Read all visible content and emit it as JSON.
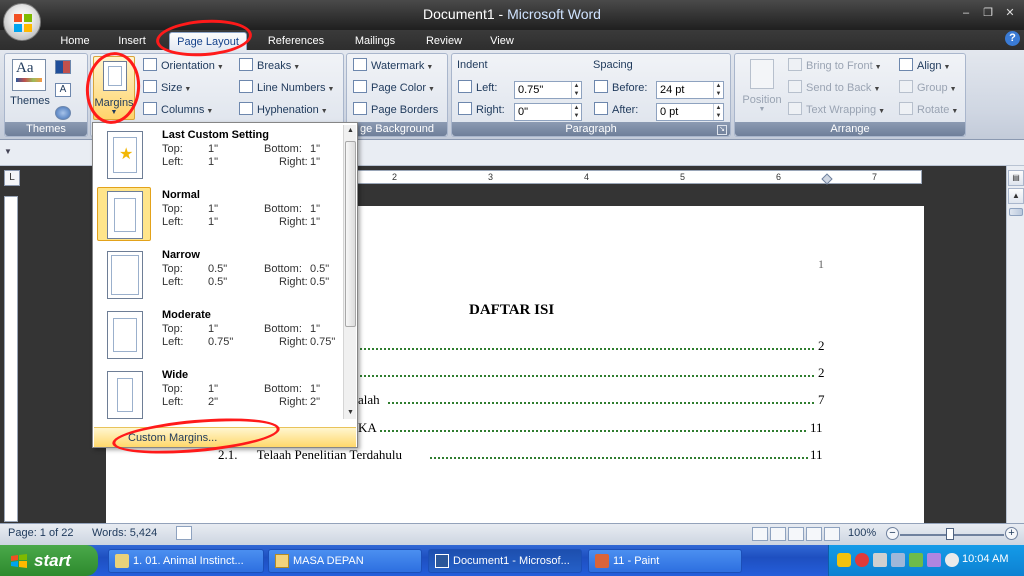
{
  "window": {
    "doc_name": "Document1",
    "title_sep": " - ",
    "app_name": "Microsoft Word",
    "minimize": "–",
    "restore": "❐",
    "close": "✕"
  },
  "tabs": [
    "Home",
    "Insert",
    "Page Layout",
    "References",
    "Mailings",
    "Review",
    "View"
  ],
  "help": "?",
  "ribbon": {
    "themes": {
      "label": "Themes",
      "group": "Themes"
    },
    "page_setup": {
      "margins": "Margins",
      "orientation": "Orientation",
      "size": "Size",
      "columns": "Columns",
      "breaks": "Breaks",
      "line_numbers": "Line Numbers",
      "hyphenation": "Hyphenation"
    },
    "page_background": {
      "watermark": "Watermark",
      "page_color": "Page Color",
      "page_borders": "Page Borders",
      "group": "ge Background"
    },
    "paragraph": {
      "indent": "Indent",
      "left_label": "Left:",
      "left_value": "0.75\"",
      "right_label": "Right:",
      "right_value": "0\"",
      "spacing": "Spacing",
      "before_label": "Before:",
      "before_value": "24 pt",
      "after_label": "After:",
      "after_value": "0 pt",
      "group": "Paragraph"
    },
    "arrange": {
      "position": "Position",
      "bring_to_front": "Bring to Front",
      "send_to_back": "Send to Back",
      "text_wrapping": "Text Wrapping",
      "align": "Align",
      "group_btn": "Group",
      "rotate": "Rotate",
      "group": "Arrange"
    }
  },
  "margins_menu": {
    "items": [
      {
        "name": "Last Custom Setting",
        "top": "1\"",
        "bottom": "1\"",
        "left": "1\"",
        "right": "1\""
      },
      {
        "name": "Normal",
        "top": "1\"",
        "bottom": "1\"",
        "left": "1\"",
        "right": "1\""
      },
      {
        "name": "Narrow",
        "top": "0.5\"",
        "bottom": "0.5\"",
        "left": "0.5\"",
        "right": "0.5\""
      },
      {
        "name": "Moderate",
        "top": "1\"",
        "bottom": "1\"",
        "left": "0.75\"",
        "right": "0.75\""
      },
      {
        "name": "Wide",
        "top": "1\"",
        "bottom": "1\"",
        "left": "2\"",
        "right": "2\""
      }
    ],
    "labels": {
      "top": "Top:",
      "bottom": "Bottom:",
      "left": "Left:",
      "right": "Right:"
    },
    "custom": "Custom Margins..."
  },
  "ruler": [
    "2",
    "3",
    "4",
    "5",
    "6",
    "7"
  ],
  "document": {
    "page_number": "1",
    "title": "DAFTAR ISI",
    "rows": [
      {
        "text": "",
        "page": "2"
      },
      {
        "text": "",
        "page": "2"
      },
      {
        "text": "alah",
        "page": "7"
      },
      {
        "text": "KA",
        "page": "11"
      },
      {
        "text": "2.1.      Telaah Penelitian Terdahulu",
        "page": "11"
      }
    ]
  },
  "status": {
    "page": "Page: 1 of 22",
    "words": "Words: 5,424",
    "zoom": "100%",
    "zoom_level_percent": 100
  },
  "taskbar": {
    "start": "start",
    "tasks": [
      "1. 01. Animal Instinct...",
      "MASA DEPAN",
      "Document1 - Microsof...",
      "11 - Paint"
    ],
    "clock": "10:04 AM"
  }
}
